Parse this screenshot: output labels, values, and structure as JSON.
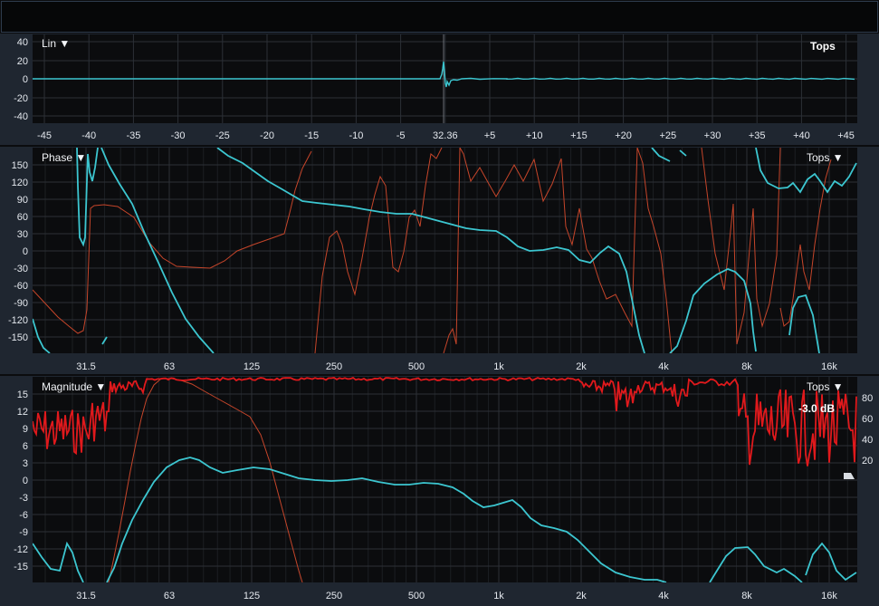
{
  "impulse_pane": {
    "mode_label": "Lin ▼",
    "right_label": "Tops",
    "y_ticks": [
      "40",
      "20",
      "0",
      "-20",
      "-40"
    ],
    "x_ticks": [
      "-45",
      "-40",
      "-35",
      "-30",
      "-25",
      "-20",
      "-15",
      "-10",
      "-5",
      "32.36",
      "+5",
      "+10",
      "+15",
      "+20",
      "+25",
      "+30",
      "+35",
      "+40",
      "+45"
    ]
  },
  "phase_pane": {
    "title": "Phase ▼",
    "right_label": "Tops ▼",
    "y_ticks": [
      "150",
      "120",
      "90",
      "60",
      "30",
      "0",
      "-30",
      "-60",
      "-90",
      "-120",
      "-150"
    ],
    "x_ticks": [
      "31.5",
      "63",
      "125",
      "250",
      "500",
      "1k",
      "2k",
      "4k",
      "8k",
      "16k"
    ]
  },
  "magnitude_pane": {
    "title": "Magnitude ▼",
    "right_label": "Tops ▼",
    "readout": "-3.0 dB",
    "y_ticks": [
      "15",
      "12",
      "9",
      "6",
      "3",
      "0",
      "-3",
      "-6",
      "-9",
      "-12",
      "-15"
    ],
    "right_ticks": [
      "80",
      "60",
      "40",
      "20"
    ],
    "x_ticks": [
      "31.5",
      "63",
      "125",
      "250",
      "500",
      "1k",
      "2k",
      "4k",
      "8k",
      "16k"
    ]
  },
  "colors": {
    "trace_cyan": "#3cc6d0",
    "trace_red": "#e0191c",
    "trace_orange": "#c5452a",
    "plot_bg": "#0b0c0e",
    "pane_bg": "#1f2630",
    "grid": "#2c3036"
  }
}
